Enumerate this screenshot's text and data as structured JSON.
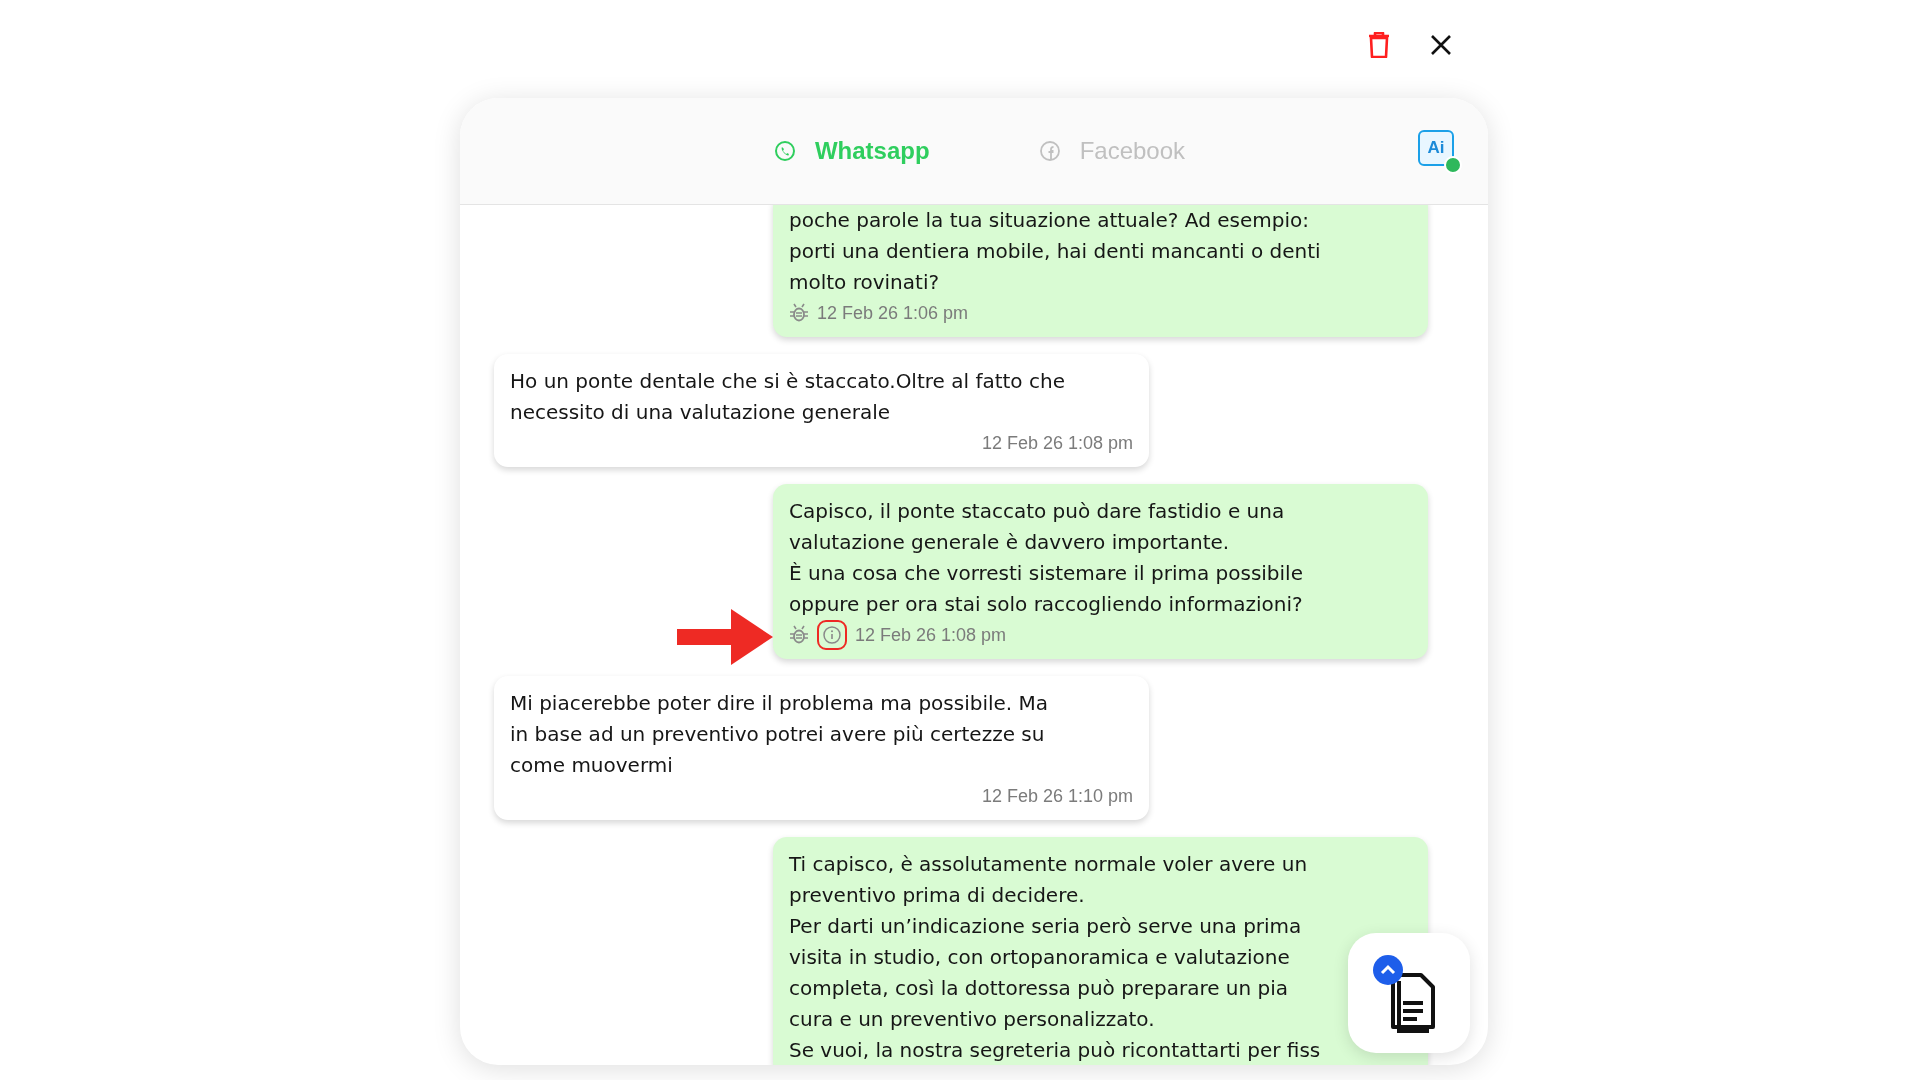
{
  "tabs": [
    {
      "label": "Whatsapp",
      "kind": "whatsapp",
      "selected": true
    },
    {
      "label": "Facebook",
      "kind": "facebook",
      "selected": false
    }
  ],
  "ai_badge": "Ai",
  "messages": [
    {
      "kind": "outgoing",
      "bot": true,
      "info": false,
      "annotated": false,
      "lines": [
        "poche parole la tua situazione attuale? Ad esempio:",
        "porti una dentiera mobile, hai denti mancanti o denti",
        "molto rovinati?"
      ],
      "time": "12 Feb 26 1:06 pm"
    },
    {
      "kind": "incoming",
      "bot": false,
      "info": false,
      "lines": [
        "Ho un ponte dentale che si è staccato.Oltre al fatto che",
        "necessito di una valutazione generale"
      ],
      "time": "12 Feb 26 1:08 pm"
    },
    {
      "kind": "outgoing",
      "bot": true,
      "info": true,
      "annotated": true,
      "lines": [
        "Capisco, il ponte staccato può dare fastidio e una",
        "valutazione generale è davvero importante.",
        "È una cosa che vorresti sistemare il prima possibile",
        "oppure per ora stai solo raccogliendo informazioni?"
      ],
      "time": "12 Feb 26 1:08 pm"
    },
    {
      "kind": "incoming",
      "bot": false,
      "info": false,
      "lines": [
        "Mi piacerebbe poter dire il problema ma possibile. Ma",
        "in base ad un preventivo potrei avere più certezze su",
        "come muovermi"
      ],
      "time": "12 Feb 26 1:10 pm"
    },
    {
      "kind": "outgoing",
      "lines": [
        "Ti capisco, è assolutamente normale voler avere un",
        "preventivo prima di decidere.",
        "Per darti un’indicazione seria però serve una prima",
        "visita in studio, con ortopanoramica e valutazione",
        "completa, così la dottoressa può preparare un pia",
        "cura e un preventivo personalizzato.",
        "Se vuoi, la nostra segreteria può ricontattarti per fiss"
      ]
    }
  ]
}
